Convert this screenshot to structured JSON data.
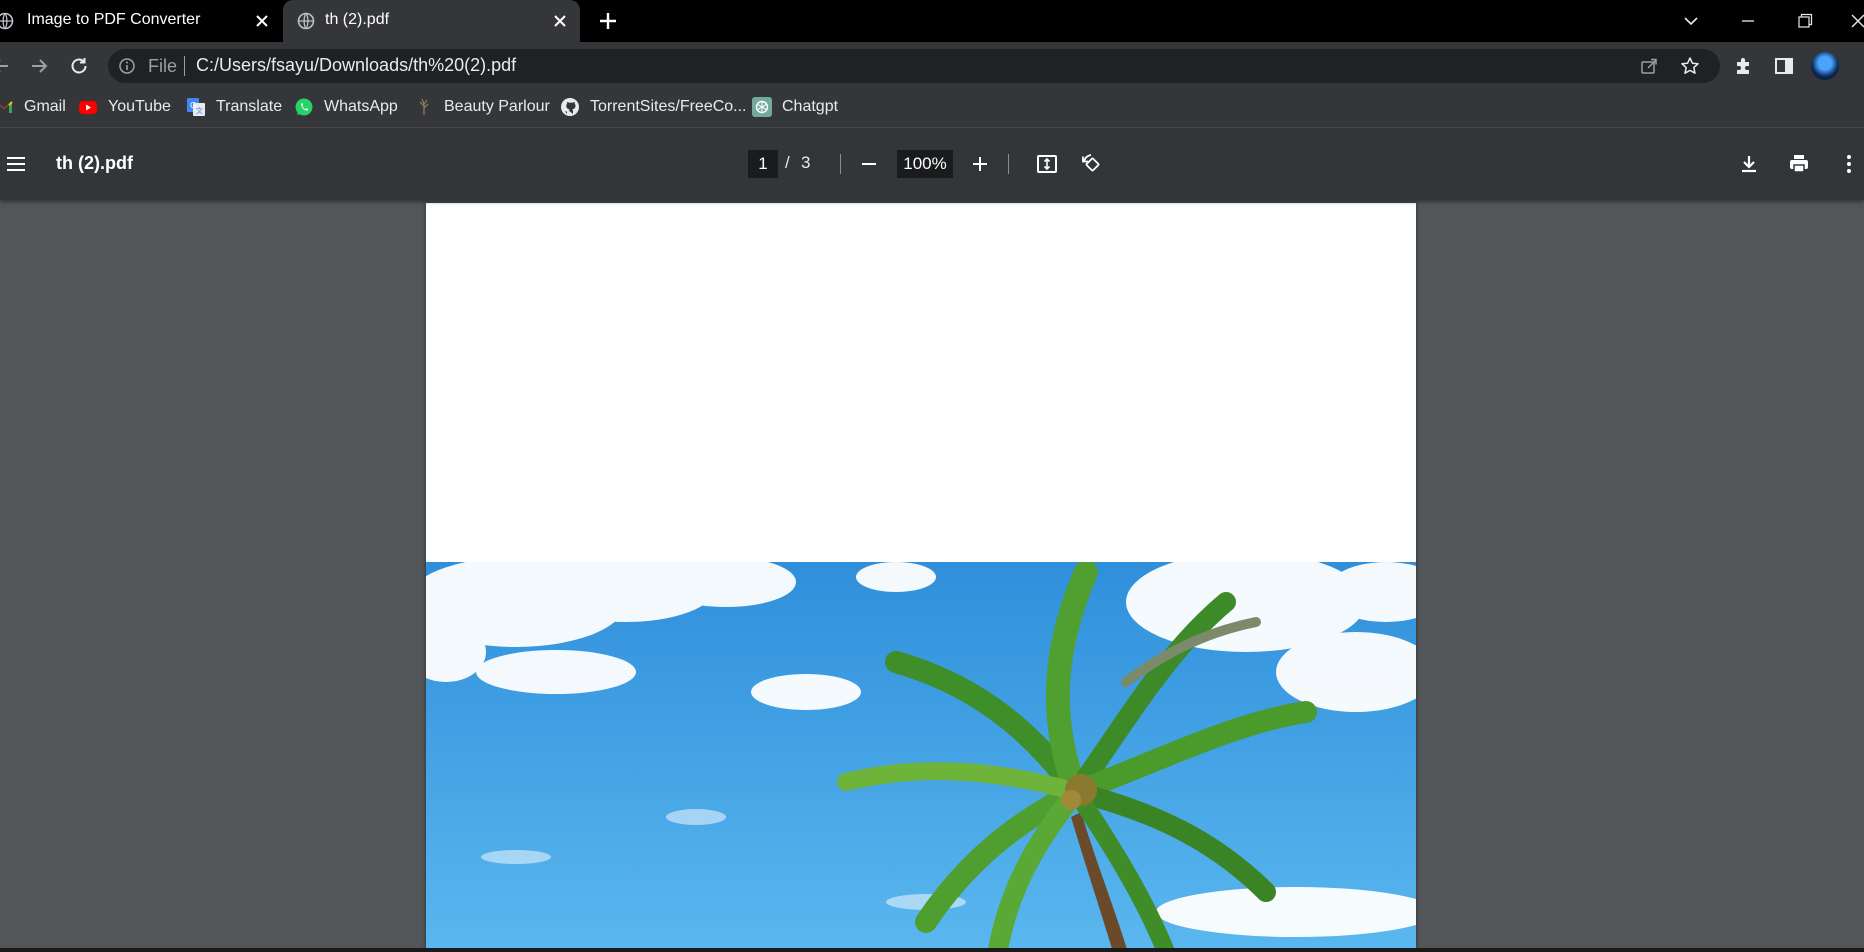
{
  "tabs": [
    {
      "title": "Image to PDF Converter",
      "active": false
    },
    {
      "title": "th (2).pdf",
      "active": true
    }
  ],
  "address_bar": {
    "scheme_label": "File",
    "url": "C:/Users/fsayu/Downloads/th%20(2).pdf"
  },
  "bookmarks": [
    {
      "label": "Gmail",
      "icon": "gmail-icon"
    },
    {
      "label": "YouTube",
      "icon": "youtube-icon"
    },
    {
      "label": "Translate",
      "icon": "translate-icon"
    },
    {
      "label": "WhatsApp",
      "icon": "whatsapp-icon"
    },
    {
      "label": "Beauty Parlour",
      "icon": "beauty-parlour-icon"
    },
    {
      "label": "TorrentSites/FreeCo...",
      "icon": "github-icon"
    },
    {
      "label": "Chatgpt",
      "icon": "chatgpt-icon"
    }
  ],
  "pdf_viewer": {
    "title": "th (2).pdf",
    "current_page": "1",
    "separator": "/",
    "total_pages": "3",
    "zoom": "100%"
  },
  "colors": {
    "tabstrip_bg": "#000000",
    "toolbar_bg": "#35363a",
    "pdf_toolbar_bg": "#323639",
    "viewer_bg": "#525659",
    "sky_blue": "#3ea6e6"
  }
}
